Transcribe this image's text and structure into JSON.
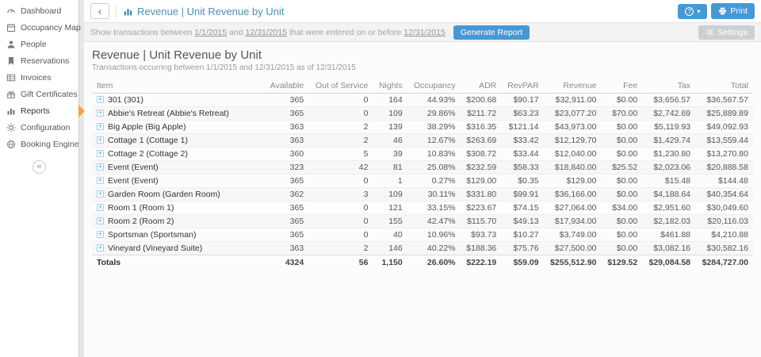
{
  "icons": {
    "back_chevron": "‹",
    "caret_down": "▾",
    "collapse_chevrons": "«",
    "expand_plus": "+",
    "help_question": "?"
  },
  "colors": {
    "accent_blue": "#4798d3",
    "title_blue": "#4a8fb0",
    "active_arrow_orange": "#f0a63f",
    "settings_gray": "#cdd0d1"
  },
  "sidebar": {
    "items": [
      {
        "label": "Dashboard",
        "icon": "gauge-icon",
        "active": false
      },
      {
        "label": "Occupancy Map",
        "icon": "calendar-icon",
        "active": false
      },
      {
        "label": "People",
        "icon": "person-icon",
        "active": false
      },
      {
        "label": "Reservations",
        "icon": "bookmark-icon",
        "active": false
      },
      {
        "label": "Invoices",
        "icon": "table-icon",
        "active": false
      },
      {
        "label": "Gift Certificates",
        "icon": "gift-icon",
        "active": false
      },
      {
        "label": "Reports",
        "icon": "bar-chart-icon",
        "active": true
      },
      {
        "label": "Configuration",
        "icon": "gear-icon",
        "active": false
      },
      {
        "label": "Booking Engine",
        "icon": "globe-icon",
        "active": false
      }
    ]
  },
  "header": {
    "title": "Revenue | Unit Revenue by Unit",
    "print_label": "Print"
  },
  "filter_bar": {
    "prefix": "Show transactions between",
    "start_date": "1/1/2015",
    "conjunction": "and",
    "end_date": "12/31/2015",
    "middle": "that were entered on or before",
    "entered_date": "12/31/2015",
    "generate_label": "Generate Report",
    "settings_label": "Settings"
  },
  "report": {
    "title": "Revenue | Unit Revenue by Unit",
    "subtitle": "Transactions occurring between 1/1/2015 and 12/31/2015 as of 12/31/2015",
    "columns": [
      "Item",
      "Available",
      "Out of Service",
      "Nights",
      "Occupancy",
      "ADR",
      "RevPAR",
      "Revenue",
      "Fee",
      "Tax",
      "Total"
    ],
    "rows": [
      {
        "item": "301 (301)",
        "cells": [
          "365",
          "0",
          "164",
          "44.93%",
          "$200.68",
          "$90.17",
          "$32,911.00",
          "$0.00",
          "$3,656.57",
          "$36,567.57"
        ]
      },
      {
        "item": "Abbie's Retreat (Abbie's Retreat)",
        "cells": [
          "365",
          "0",
          "109",
          "29.86%",
          "$211.72",
          "$63.23",
          "$23,077.20",
          "$70.00",
          "$2,742.69",
          "$25,889.89"
        ]
      },
      {
        "item": "Big Apple (Big Apple)",
        "cells": [
          "363",
          "2",
          "139",
          "38.29%",
          "$316.35",
          "$121.14",
          "$43,973.00",
          "$0.00",
          "$5,119.93",
          "$49,092.93"
        ]
      },
      {
        "item": "Cottage 1 (Cottage 1)",
        "cells": [
          "363",
          "2",
          "46",
          "12.67%",
          "$263.69",
          "$33.42",
          "$12,129.70",
          "$0.00",
          "$1,429.74",
          "$13,559.44"
        ]
      },
      {
        "item": "Cottage 2 (Cottage 2)",
        "cells": [
          "360",
          "5",
          "39",
          "10.83%",
          "$308.72",
          "$33.44",
          "$12,040.00",
          "$0.00",
          "$1,230.80",
          "$13,270.80"
        ]
      },
      {
        "item": "Event (Event)",
        "cells": [
          "323",
          "42",
          "81",
          "25.08%",
          "$232.59",
          "$58.33",
          "$18,840.00",
          "$25.52",
          "$2,023.06",
          "$20,888.58"
        ]
      },
      {
        "item": "Event (Event)",
        "cells": [
          "365",
          "0",
          "1",
          "0.27%",
          "$129.00",
          "$0.35",
          "$129.00",
          "$0.00",
          "$15.48",
          "$144.48"
        ]
      },
      {
        "item": "Garden Room (Garden Room)",
        "cells": [
          "362",
          "3",
          "109",
          "30.11%",
          "$331.80",
          "$99.91",
          "$36,166.00",
          "$0.00",
          "$4,188.64",
          "$40,354.64"
        ]
      },
      {
        "item": "Room 1 (Room 1)",
        "cells": [
          "365",
          "0",
          "121",
          "33.15%",
          "$223.67",
          "$74.15",
          "$27,064.00",
          "$34.00",
          "$2,951.60",
          "$30,049.60"
        ]
      },
      {
        "item": "Room 2 (Room 2)",
        "cells": [
          "365",
          "0",
          "155",
          "42.47%",
          "$115.70",
          "$49.13",
          "$17,934.00",
          "$0.00",
          "$2,182.03",
          "$20,116.03"
        ]
      },
      {
        "item": "Sportsman (Sportsman)",
        "cells": [
          "365",
          "0",
          "40",
          "10.96%",
          "$93.73",
          "$10.27",
          "$3,749.00",
          "$0.00",
          "$461.88",
          "$4,210.88"
        ]
      },
      {
        "item": "Vineyard (Vineyard Suite)",
        "cells": [
          "363",
          "2",
          "146",
          "40.22%",
          "$188.36",
          "$75.76",
          "$27,500.00",
          "$0.00",
          "$3,082.16",
          "$30,582.16"
        ]
      }
    ],
    "totals_label": "Totals",
    "totals": [
      "4324",
      "56",
      "1,150",
      "26.60%",
      "$222.19",
      "$59.09",
      "$255,512.90",
      "$129.52",
      "$29,084.58",
      "$284,727.00"
    ]
  }
}
